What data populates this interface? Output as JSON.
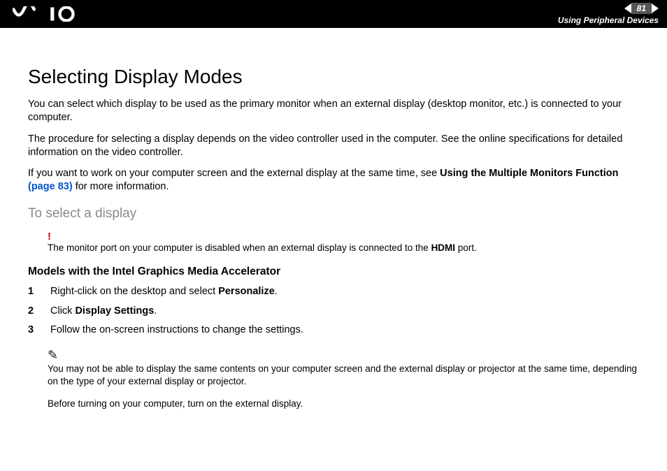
{
  "header": {
    "page_number": "81",
    "section": "Using Peripheral Devices"
  },
  "content": {
    "title": "Selecting Display Modes",
    "para1": "You can select which display to be used as the primary monitor when an external display (desktop monitor, etc.) is connected to your computer.",
    "para2": "The procedure for selecting a display depends on the video controller used in the computer. See the online specifications for detailed information on the video controller.",
    "para3_a": "If you want to work on your computer screen and the external display at the same time, see ",
    "para3_b": "Using the Multiple Monitors Function",
    "para3_link": "(page 83)",
    "para3_c": " for more information.",
    "subheading": "To select a display",
    "warn_mark": "!",
    "warn_text_a": "The monitor port on your computer is disabled when an external display is connected to the ",
    "warn_text_b": "HDMI",
    "warn_text_c": " port.",
    "model_heading": "Models with the Intel Graphics Media Accelerator",
    "steps": [
      {
        "n": "1",
        "a": "Right-click on the desktop and select ",
        "b": "Personalize",
        "c": "."
      },
      {
        "n": "2",
        "a": "Click ",
        "b": "Display Settings",
        "c": "."
      },
      {
        "n": "3",
        "a": "Follow the on-screen instructions to change the settings.",
        "b": "",
        "c": ""
      }
    ],
    "pencil_mark": "✎",
    "note1": "You may not be able to display the same contents on your computer screen and the external display or projector at the same time, depending on the type of your external display or projector.",
    "note2": "Before turning on your computer, turn on the external display."
  }
}
